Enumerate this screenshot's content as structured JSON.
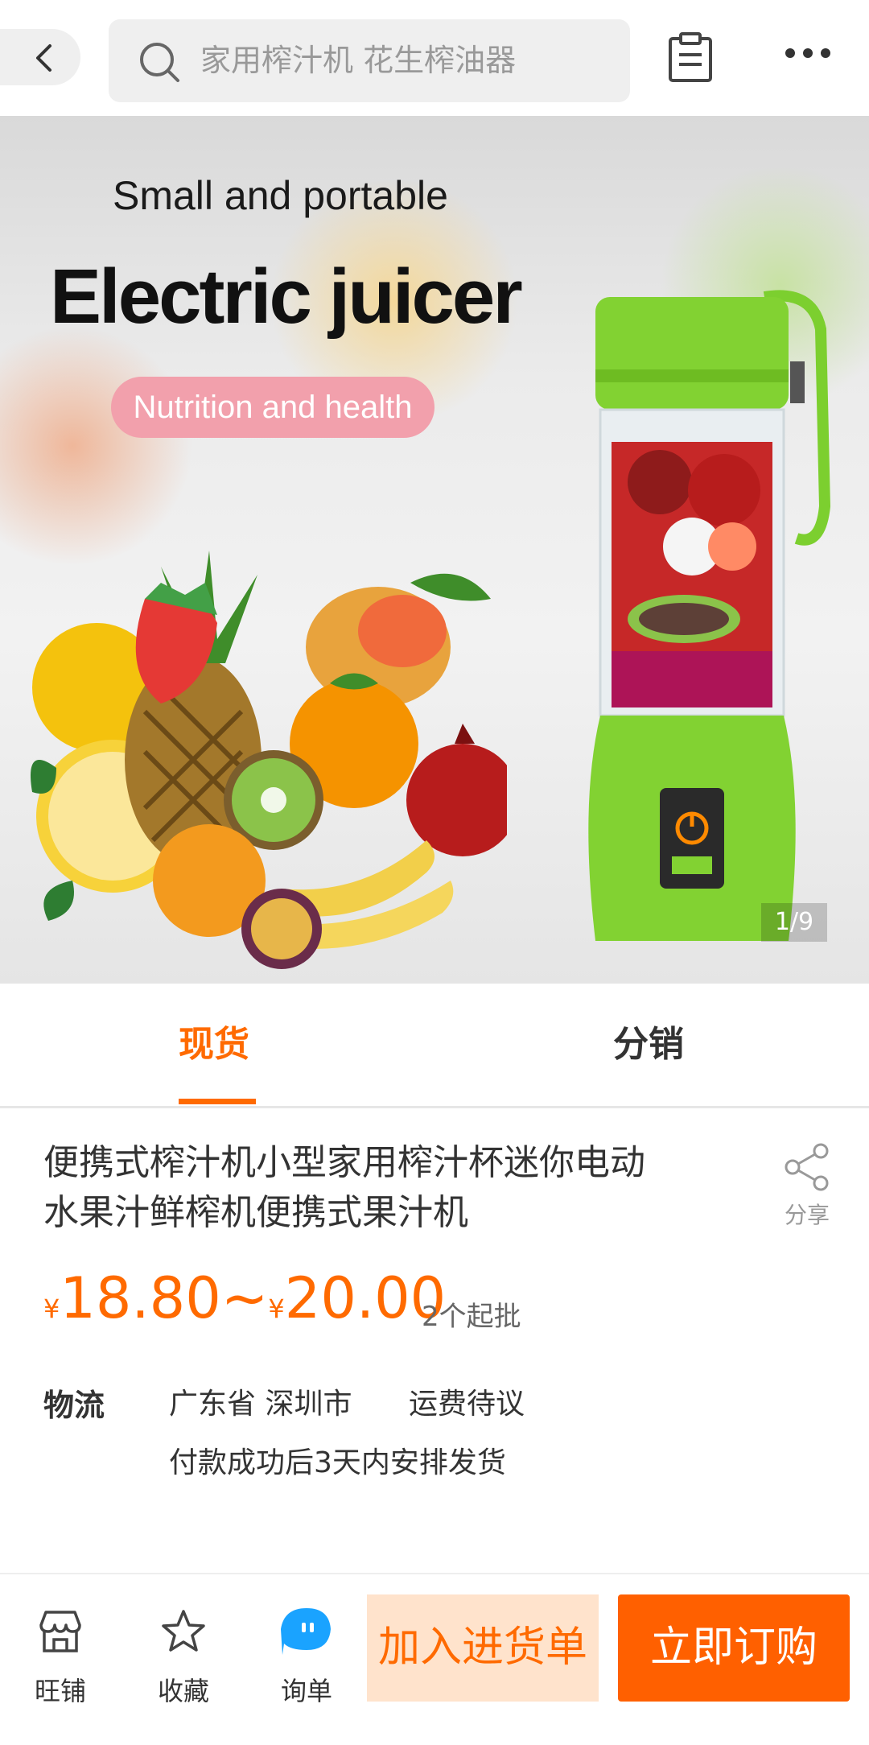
{
  "search": {
    "query": "家用榨汁机 花生榨油器"
  },
  "hero": {
    "subtitle": "Small and portable",
    "title": "Electric juicer",
    "badge": "Nutrition and health",
    "counter": "1/9"
  },
  "tabs": [
    {
      "label": "现货",
      "active": true
    },
    {
      "label": "分销",
      "active": false
    }
  ],
  "product": {
    "title_line1": "便携式榨汁机小型家用榨汁杯迷你电动",
    "title_line2": "水果汁鲜榨机便携式果汁机",
    "share_label": "分享",
    "price_currency": "¥",
    "price_low": "18.80",
    "price_sep": "~",
    "price_high": "20.00",
    "moq": "2个起批"
  },
  "logistics": {
    "label": "物流",
    "location": "广东省 深圳市",
    "fee": "运费待议",
    "shipping": "付款成功后3天内安排发货"
  },
  "bottom_bar": {
    "store_label": "旺铺",
    "favorite_label": "收藏",
    "inquiry_label": "询单",
    "add_cart_label": "加入进货单",
    "buy_now_label": "立即订购"
  },
  "colors": {
    "accent": "#ff6a00",
    "buy_button": "#ff6000",
    "cart_button_bg": "#ffe3cc",
    "inquiry_icon": "#1aa3ff"
  }
}
